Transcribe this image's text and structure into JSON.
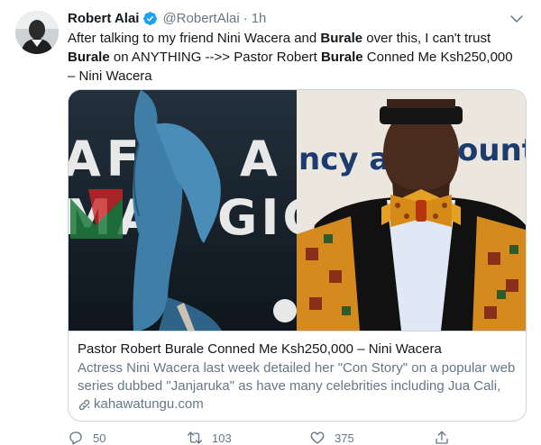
{
  "tweet": {
    "author_name": "Robert Alai",
    "handle": "@RobertAlai",
    "separator": "·",
    "time": "1h",
    "text": [
      {
        "t": "After talking to my friend Nini Wacera and ",
        "bold": false
      },
      {
        "t": "Burale",
        "bold": true
      },
      {
        "t": " over this, I can't trust ",
        "bold": false
      },
      {
        "t": "Burale",
        "bold": true
      },
      {
        "t": " on ANYTHING -->> Pastor Robert ",
        "bold": false
      },
      {
        "t": "Burale",
        "bold": true
      },
      {
        "t": " Conned Me Ksh250,000 – Nini Wacera",
        "bold": false
      }
    ]
  },
  "card": {
    "title": "Pastor Robert Burale Conned Me Ksh250,000 – Nini Wacera",
    "description": "Actress Nini Wacera last week detailed her \"Con Story\" on a popular web series dubbed \"Janjaruka\" as have many celebrities including Jua Cali, …",
    "domain": "kahawatungu.com",
    "left_photo_text": "AFRICA MAGIC",
    "right_photo_text": "ncy and Accounta"
  },
  "actions": {
    "replies": "50",
    "retweets": "103",
    "likes": "375"
  },
  "colors": {
    "verified": "#1da1f2",
    "secondary_text": "#657786",
    "border": "#ccd6dd"
  },
  "icons": [
    "verified-icon",
    "chevron-down-icon",
    "link-icon",
    "reply-icon",
    "retweet-icon",
    "like-icon",
    "share-icon"
  ]
}
